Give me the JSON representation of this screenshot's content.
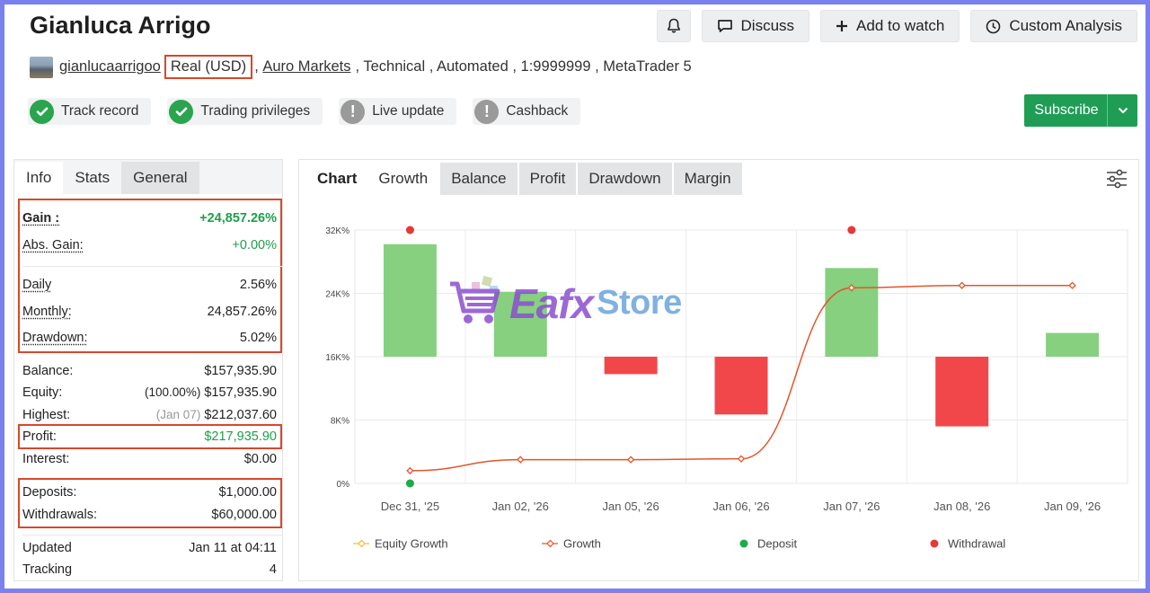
{
  "header": {
    "title": "Gianluca Arrigo",
    "buttons": {
      "discuss": "Discuss",
      "watch": "Add to watch",
      "analysis": "Custom Analysis"
    }
  },
  "meta": {
    "username": "gianlucaarrigoo",
    "account_type": "Real (USD)",
    "broker": "Auro Markets",
    "rest": ", Technical , Automated , 1:9999999 , MetaTrader 5"
  },
  "badges": [
    {
      "label": "Track record",
      "status": "ok"
    },
    {
      "label": "Trading privileges",
      "status": "ok"
    },
    {
      "label": "Live update",
      "status": "off"
    },
    {
      "label": "Cashback",
      "status": "off"
    }
  ],
  "subscribe": {
    "label": "Subscribe"
  },
  "left_tabs": [
    "Info",
    "Stats",
    "General"
  ],
  "stats": {
    "gain": {
      "label": "Gain :",
      "value": "+24,857.26%"
    },
    "abs_gain": {
      "label": "Abs. Gain:",
      "value": "+0.00%"
    },
    "daily": {
      "label": "Daily",
      "value": "2.56%"
    },
    "monthly": {
      "label": "Monthly:",
      "value": "24,857.26%"
    },
    "drawdown": {
      "label": "Drawdown:",
      "value": "5.02%"
    },
    "balance": {
      "label": "Balance:",
      "value": "$157,935.90"
    },
    "equity": {
      "label": "Equity:",
      "pct": "(100.00%)",
      "value": "$157,935.90"
    },
    "highest": {
      "label": "Highest:",
      "date": "(Jan 07)",
      "value": "$212,037.60"
    },
    "profit": {
      "label": "Profit:",
      "value": "$217,935.90"
    },
    "interest": {
      "label": "Interest:",
      "value": "$0.00"
    },
    "deposits": {
      "label": "Deposits:",
      "value": "$1,000.00"
    },
    "withdrawals": {
      "label": "Withdrawals:",
      "value": "$60,000.00"
    },
    "updated": {
      "label": "Updated",
      "value": "Jan 11 at 04:11"
    },
    "tracking": {
      "label": "Tracking",
      "value": "4"
    }
  },
  "chart_tabs": [
    "Chart",
    "Growth",
    "Balance",
    "Profit",
    "Drawdown",
    "Margin"
  ],
  "watermark": {
    "part1": "Eafx",
    "part2": "Store"
  },
  "chart_data": {
    "type": "bar",
    "categories": [
      "Dec 31, '25",
      "Jan 02, '26",
      "Jan 05, '26",
      "Jan 06, '26",
      "Jan 07, '26",
      "Jan 08, '26",
      "Jan 09, '26"
    ],
    "ytick_labels": [
      "0%",
      "8K%",
      "16K%",
      "24K%",
      "32K%"
    ],
    "yticks": [
      0,
      8000,
      16000,
      24000,
      32000
    ],
    "ylim": [
      0,
      32000
    ],
    "baseline": 16000,
    "bars": [
      30200,
      24200,
      13800,
      8700,
      27200,
      7200,
      19000
    ],
    "colors": {
      "positive": "#86d07f",
      "negative": "#f2474a",
      "growth": "#e2562b",
      "equity": "#f1c232",
      "deposit": "#1cab4a",
      "withdrawal": "#e53935"
    },
    "series": [
      {
        "name": "Growth",
        "values": [
          1600,
          3000,
          3000,
          3100,
          24700,
          25000,
          25000
        ]
      }
    ],
    "deposit_points": [
      {
        "index": 0,
        "value": 0
      }
    ],
    "withdrawal_points": [
      {
        "index": 0,
        "value": 32000
      },
      {
        "index": 4,
        "value": 32000
      }
    ],
    "legend": [
      "Equity Growth",
      "Growth",
      "Deposit",
      "Withdrawal"
    ],
    "grid": true
  }
}
